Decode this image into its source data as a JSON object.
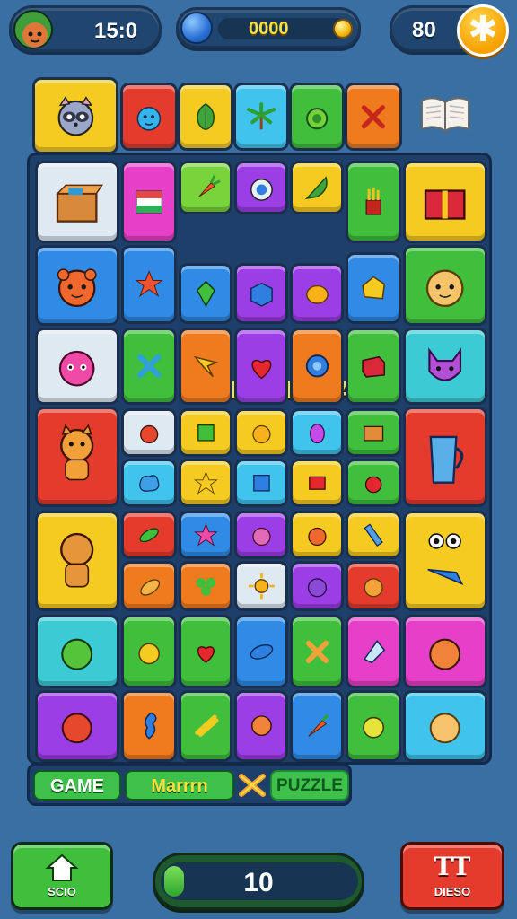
{
  "hud": {
    "timer": "15:0",
    "score": "0000",
    "stars": "80",
    "star_button_glyph": "✱"
  },
  "board": {
    "title": "UHAAENAAH"
  },
  "labels": {
    "game": "GAME",
    "match": "Marrrn",
    "puzzle": "PUZZLE"
  },
  "buttons": {
    "home_label": "SCIO",
    "restart_glyph": "TT",
    "restart_label": "DIESO"
  },
  "moves": "10",
  "colors": {
    "background": "#3a6fa3",
    "board": "#1d3f6a",
    "title": "#f8e03b"
  },
  "icons": [
    "avatar-icon",
    "coin-icon",
    "star-icon",
    "book-icon",
    "home-icon"
  ]
}
